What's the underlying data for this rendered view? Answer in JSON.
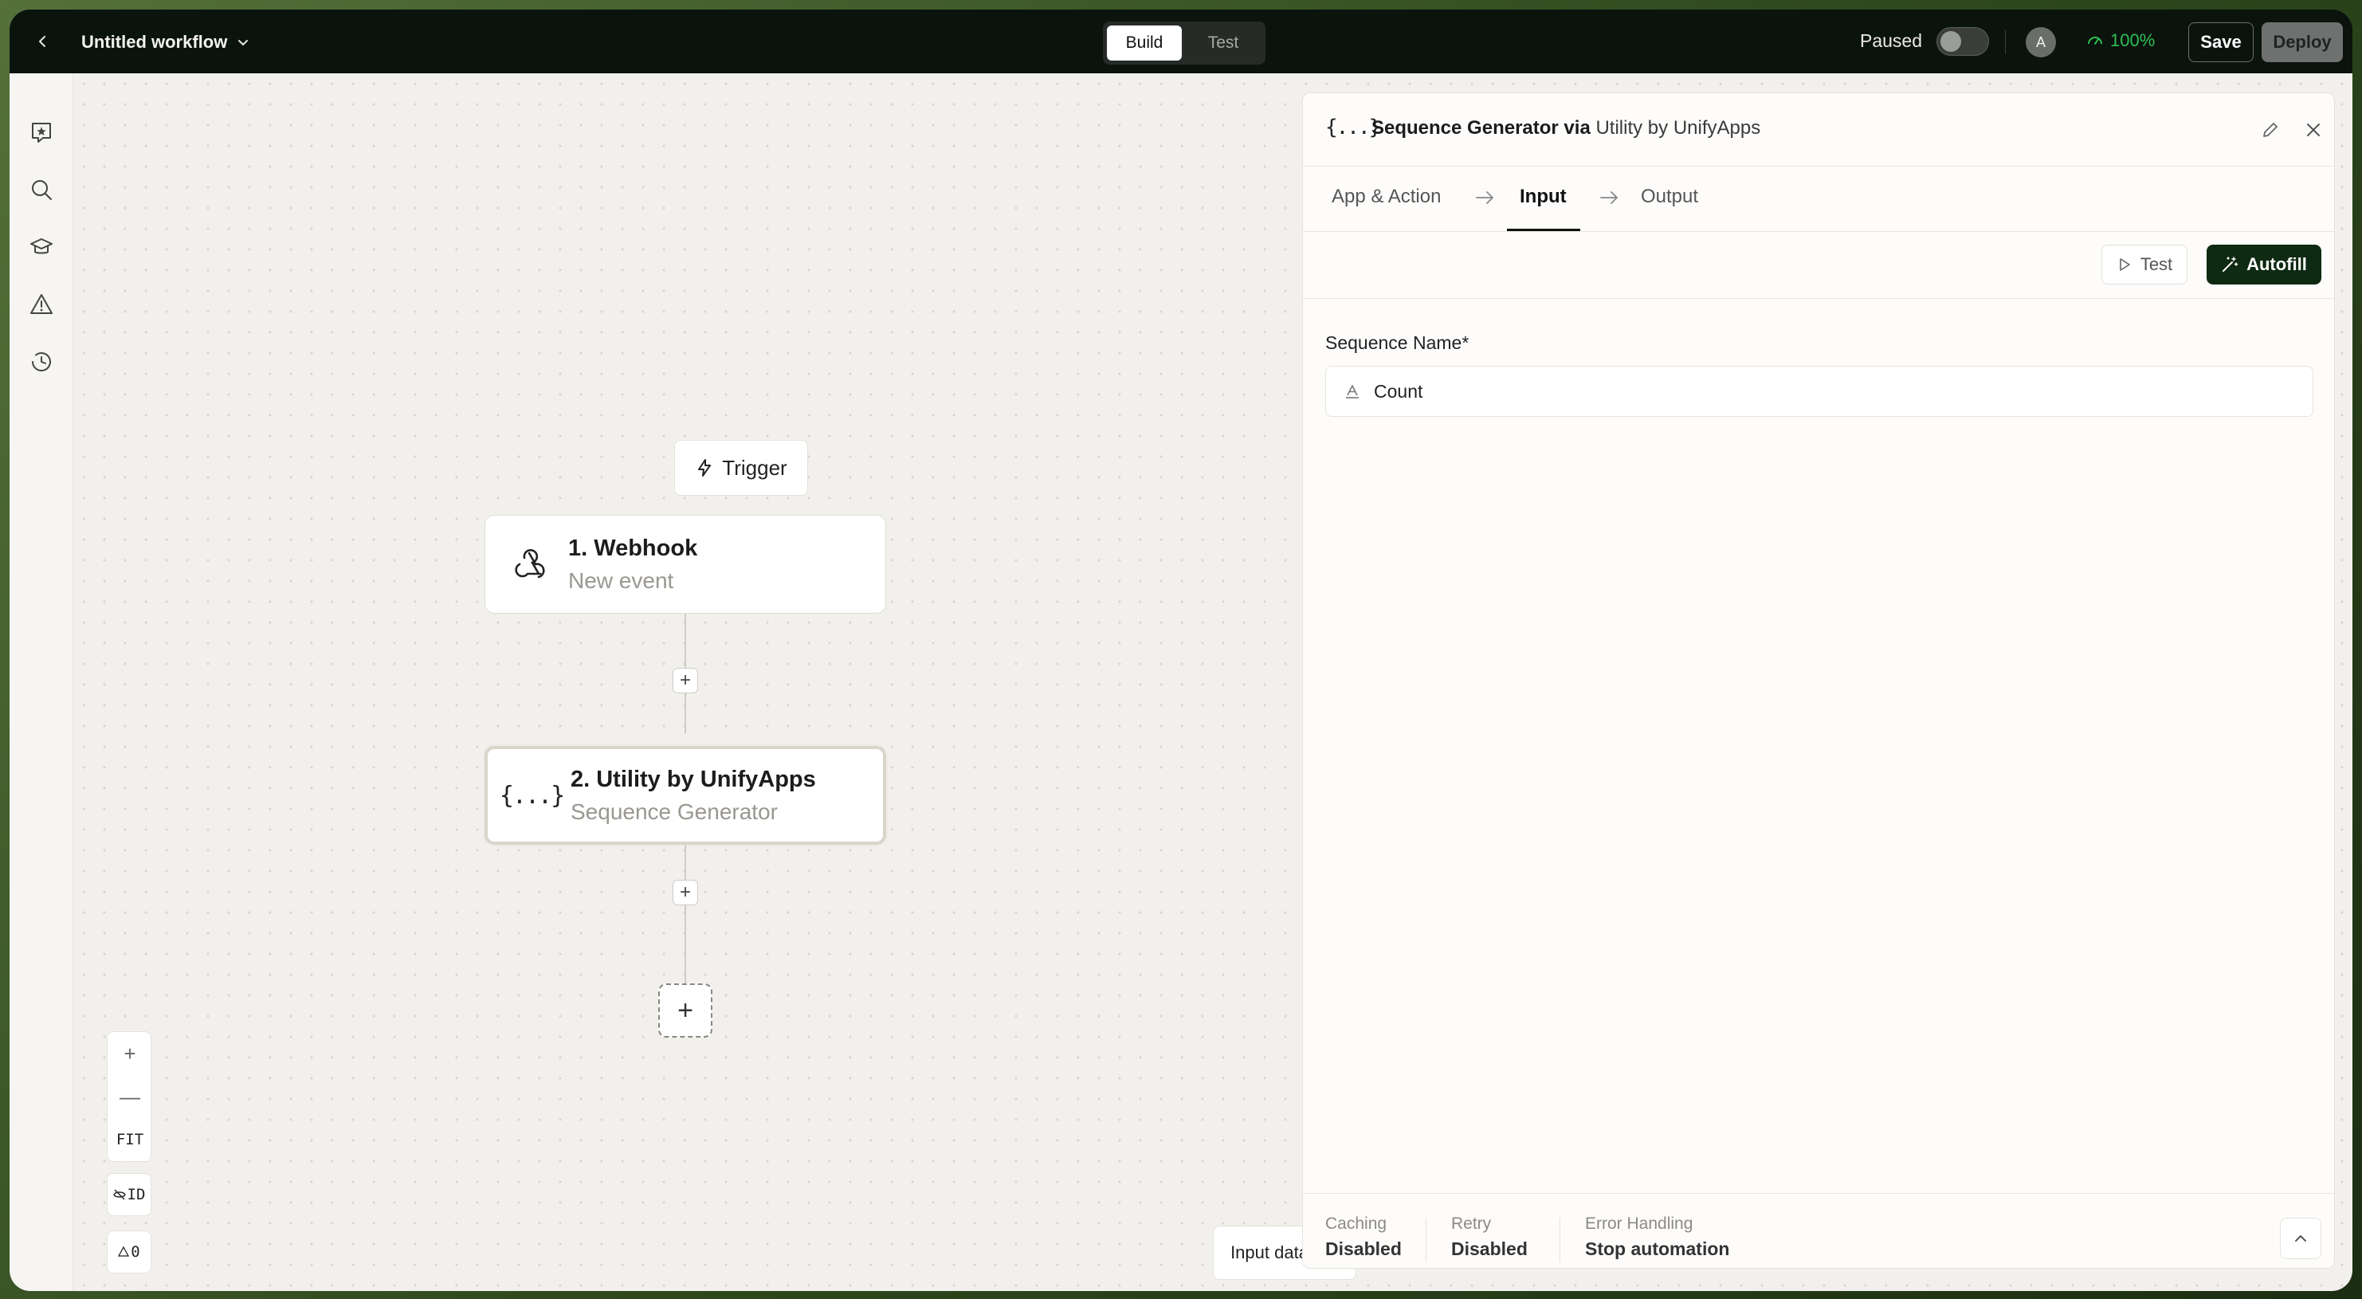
{
  "topbar": {
    "workflow_title": "Untitled workflow",
    "modes": [
      "Build",
      "Test"
    ],
    "active_mode": "Build",
    "status_label": "Paused",
    "avatar_initial": "A",
    "health_percent": "100%",
    "save_label": "Save",
    "deploy_label": "Deploy"
  },
  "sidebar": {
    "icons": [
      "ai-star-icon",
      "search-icon",
      "learn-icon",
      "warning-icon",
      "history-icon"
    ]
  },
  "canvas": {
    "trigger_label": "Trigger",
    "nodes": [
      {
        "title": "1. Webhook",
        "subtitle": "New event",
        "icon": "webhook-icon"
      },
      {
        "title": "2. Utility by UnifyApps",
        "subtitle": "Sequence Generator",
        "icon": "braces-icon",
        "icon_text": "{...}"
      }
    ],
    "zoom": {
      "in": "+",
      "out": "—",
      "fit": "FIT"
    },
    "id_toggle": "ID",
    "warnings_count": "0",
    "input_data_label": "Input data"
  },
  "panel": {
    "header_icon_text": "{...}",
    "title_action": "Sequence Generator",
    "title_via": "via",
    "title_app": "Utility by UnifyApps",
    "steps": [
      "App & Action",
      "Input",
      "Output"
    ],
    "active_step": "Input",
    "test_label": "Test",
    "autofill_label": "Autofill",
    "field": {
      "label": "Sequence Name*",
      "value": "Count"
    },
    "footer": [
      {
        "label": "Caching",
        "value": "Disabled"
      },
      {
        "label": "Retry",
        "value": "Disabled"
      },
      {
        "label": "Error Handling",
        "value": "Stop automation"
      }
    ]
  },
  "colors": {
    "accent_dark_green": "#0f2a12",
    "health_green": "#2fbf55",
    "topbar_bg": "#0b130d"
  }
}
